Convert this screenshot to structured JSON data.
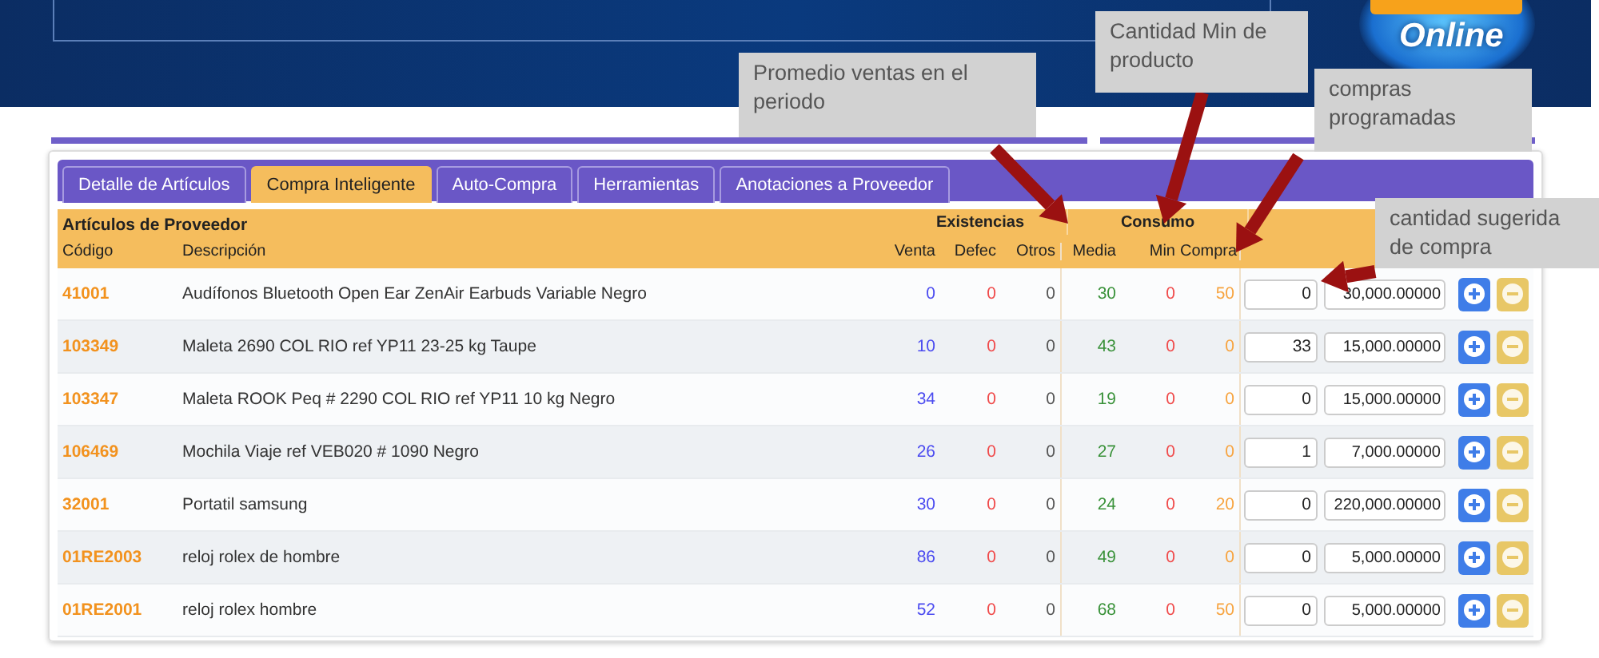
{
  "logo": {
    "text": "Online"
  },
  "tabs": [
    {
      "label": "Detalle de Artículos",
      "selected": false
    },
    {
      "label": "Compra Inteligente",
      "selected": true
    },
    {
      "label": "Auto-Compra",
      "selected": false
    },
    {
      "label": "Herramientas",
      "selected": false
    },
    {
      "label": "Anotaciones a Proveedor",
      "selected": false
    }
  ],
  "table": {
    "title": "Artículos de Proveedor",
    "groups": [
      "Existencias",
      "Consumo"
    ],
    "columns": [
      "Código",
      "Descripción",
      "Venta",
      "Defec",
      "Otros",
      "Media",
      "Min",
      "Compra"
    ],
    "rows": [
      {
        "cells": [
          "41001",
          "Audífonos Bluetooth Open Ear ZenAir Earbuds Variable Negro",
          "0",
          "0",
          "0",
          "30",
          "0",
          "50"
        ],
        "quantity": "0",
        "price": "30,000.00000"
      },
      {
        "cells": [
          "103349",
          "Maleta 2690 COL RIO ref YP11 23-25 kg Taupe",
          "10",
          "0",
          "0",
          "43",
          "0",
          "0"
        ],
        "quantity": "33",
        "price": "15,000.00000"
      },
      {
        "cells": [
          "103347",
          "Maleta ROOK Peq # 2290 COL RIO ref YP11 10 kg Negro",
          "34",
          "0",
          "0",
          "19",
          "0",
          "0"
        ],
        "quantity": "0",
        "price": "15,000.00000"
      },
      {
        "cells": [
          "106469",
          "Mochila Viaje ref VEB020 # 1090 Negro",
          "26",
          "0",
          "0",
          "27",
          "0",
          "0"
        ],
        "quantity": "1",
        "price": "7,000.00000"
      },
      {
        "cells": [
          "32001",
          "Portatil samsung",
          "30",
          "0",
          "0",
          "24",
          "0",
          "20"
        ],
        "quantity": "0",
        "price": "220,000.00000"
      },
      {
        "cells": [
          "01RE2003",
          "reloj rolex de hombre",
          "86",
          "0",
          "0",
          "49",
          "0",
          "0"
        ],
        "quantity": "0",
        "price": "5,000.00000"
      },
      {
        "cells": [
          "01RE2001",
          "reloj rolex hombre",
          "52",
          "0",
          "0",
          "68",
          "0",
          "50"
        ],
        "quantity": "0",
        "price": "5,000.00000"
      }
    ]
  },
  "callouts": [
    {
      "text": "Promedio ventas en el periodo"
    },
    {
      "text": "Cantidad Min de producto"
    },
    {
      "text": "compras programadas"
    },
    {
      "text": "cantidad sugerida de compra"
    }
  ]
}
